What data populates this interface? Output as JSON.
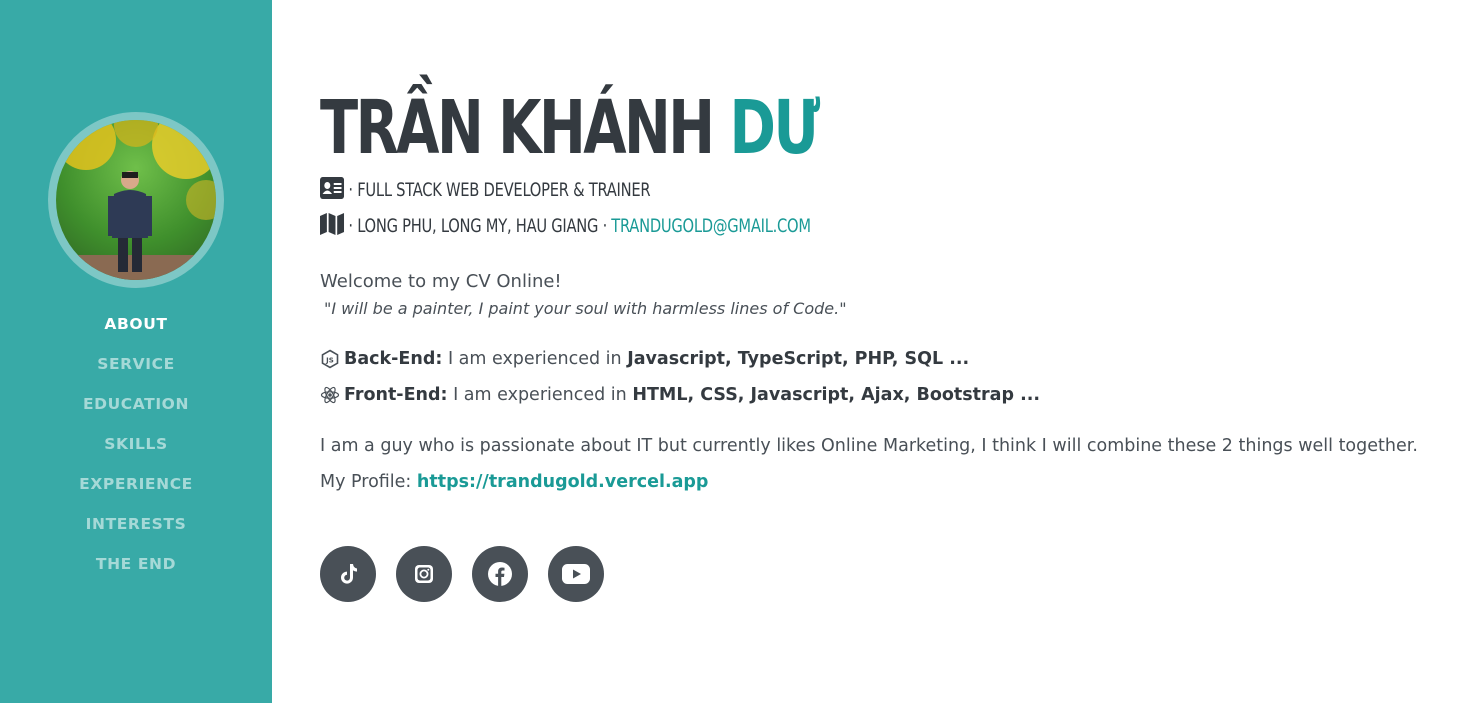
{
  "sidebar": {
    "nav": [
      {
        "label": "ABOUT",
        "active": true
      },
      {
        "label": "SERVICE",
        "active": false
      },
      {
        "label": "EDUCATION",
        "active": false
      },
      {
        "label": "SKILLS",
        "active": false
      },
      {
        "label": "EXPERIENCE",
        "active": false
      },
      {
        "label": "INTERESTS",
        "active": false
      },
      {
        "label": "THE END",
        "active": false
      }
    ],
    "background_color": "#38aaa7"
  },
  "header": {
    "first_name": "TRẦN KHÁNH",
    "last_name": "DƯ",
    "title": "· FULL STACK WEB DEVELOPER & TRAINER",
    "address": "· LONG PHU, LONG MY, HAU GIANG ·",
    "email": "TRANDUGOLD@GMAIL.COM",
    "title_icon": "id-card-icon",
    "address_icon": "map-icon"
  },
  "intro": {
    "welcome": "Welcome to my CV Online!",
    "quote": "\"I will be a painter, I paint your soul with harmless lines of Code.\""
  },
  "skills": [
    {
      "icon": "nodejs-icon",
      "label": "Back-End:",
      "text": " I am experienced in ",
      "tech": "Javascript, TypeScript, PHP, SQL ..."
    },
    {
      "icon": "react-icon",
      "label": "Front-End:",
      "text": " I am experienced in ",
      "tech": "HTML, CSS, Javascript, Ajax, Bootstrap ..."
    }
  ],
  "about": "I am a guy who is passionate about IT but currently likes Online Marketing, I think I will combine these 2 things well together.",
  "profile": {
    "label": "My Profile: ",
    "url": "https://trandugold.vercel.app"
  },
  "socials": [
    {
      "icon": "tiktok-icon"
    },
    {
      "icon": "instagram-icon"
    },
    {
      "icon": "facebook-icon"
    },
    {
      "icon": "youtube-icon"
    }
  ],
  "colors": {
    "accent": "#1a9a96",
    "text_dark": "#343a40",
    "social_bg": "#495057"
  }
}
